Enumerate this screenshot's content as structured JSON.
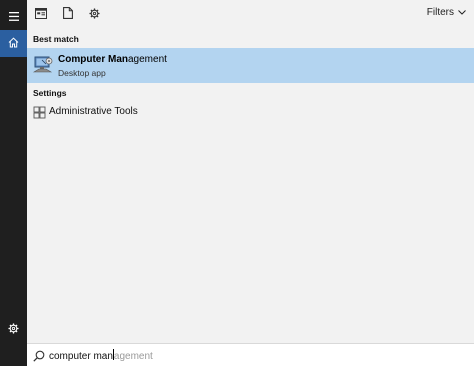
{
  "toolbar": {
    "apps_icon": "apps-icon",
    "documents_icon": "document-icon",
    "settings_icon": "gear-icon",
    "filters_label": "Filters",
    "filters_icon": "chevron-down-icon"
  },
  "rail": {
    "menu_icon": "hamburger-icon",
    "home_icon": "home-icon",
    "settings_icon": "gear-icon",
    "accent_color": "#2b5fa0"
  },
  "results": {
    "best_match_header": "Best match",
    "best_match": {
      "title_bold": "Computer Man",
      "title_rest": "agement",
      "subtitle": "Desktop app",
      "icon": "computer-management-icon",
      "highlight_color": "#b3d4f0"
    },
    "settings_header": "Settings",
    "settings_items": [
      {
        "label": "Administrative Tools",
        "icon": "administrative-tools-icon"
      }
    ]
  },
  "search": {
    "typed": "computer man",
    "suggestion": "agement",
    "icon": "search-icon"
  }
}
